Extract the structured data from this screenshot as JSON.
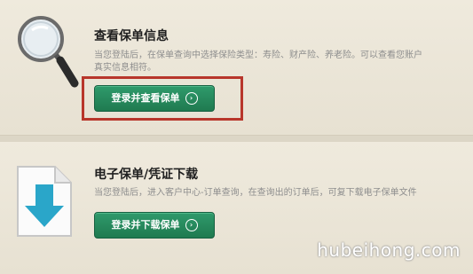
{
  "section1": {
    "title": "查看保单信息",
    "desc_line1": "当您登陆后，在保单查询中选择保险类型：寿险、财产险、养老险。可以查看您账户",
    "desc_line2": "真实信息相符。",
    "button_label": "登录并查看保单",
    "icon": "magnifier-icon"
  },
  "section2": {
    "title": "电子保单/凭证下载",
    "desc_line1": "当您登陆后，进入客户中心-订单查询，在查询出的订单后，可复下载电子保单文件",
    "button_label": "登录并下载保单",
    "icon": "download-document-icon"
  },
  "watermark": "hubeihong.com",
  "colors": {
    "button": "#1f7a50",
    "highlight": "#b8362b",
    "download_arrow": "#2aa6c9"
  }
}
